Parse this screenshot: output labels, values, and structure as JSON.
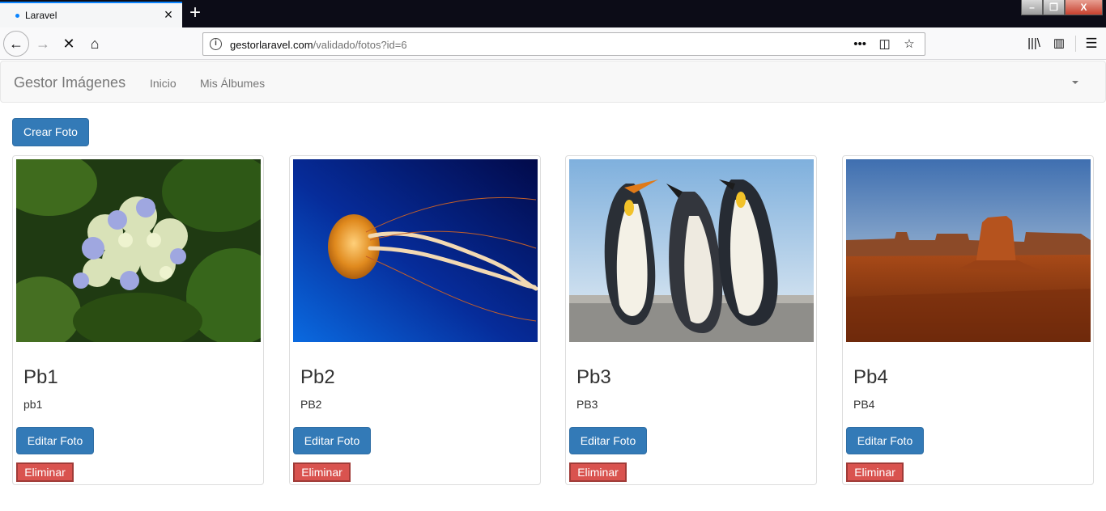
{
  "browser": {
    "tab_title": "Laravel",
    "url_domain": "gestorlaravel.com",
    "url_path": "/validado/fotos?id=6",
    "icons": [
      "back-icon",
      "forward-icon",
      "stop-icon",
      "home-icon",
      "info-icon",
      "more-icon",
      "pocket-icon",
      "bookmark-star-icon",
      "library-icon",
      "sidebar-icon",
      "menu-icon"
    ]
  },
  "navbar": {
    "brand": "Gestor Imágenes",
    "links": [
      "Inicio",
      "Mis Álbumes"
    ]
  },
  "actions": {
    "crear": "Crear Foto"
  },
  "cards": [
    {
      "title": "Pb1",
      "description": "pb1",
      "edit": "Editar Foto",
      "delete": "Eliminar",
      "image": "hydrangea-flower"
    },
    {
      "title": "Pb2",
      "description": "PB2",
      "edit": "Editar Foto",
      "delete": "Eliminar",
      "image": "jellyfish"
    },
    {
      "title": "Pb3",
      "description": "PB3",
      "edit": "Editar Foto",
      "delete": "Eliminar",
      "image": "penguins"
    },
    {
      "title": "Pb4",
      "description": "PB4",
      "edit": "Editar Foto",
      "delete": "Eliminar",
      "image": "desert-butte"
    }
  ],
  "colors": {
    "primary": "#337ab7",
    "danger": "#d9534f",
    "tab_accent": "#0a84ff"
  }
}
